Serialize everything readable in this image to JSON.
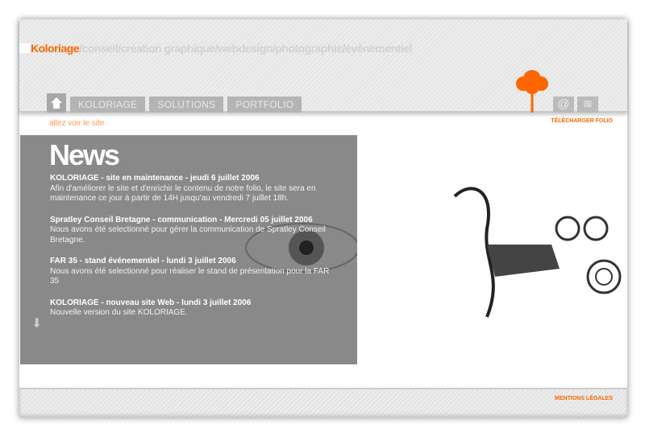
{
  "header": {
    "brand": "Koloriage",
    "slogan": "/conseil/création graphique/webdesign/photographie/événementiel"
  },
  "nav": {
    "tabs": [
      "KOLORIAGE",
      "SOLUTIONS",
      "PORTFOLIO"
    ]
  },
  "links": {
    "visit": "allez voir le site",
    "folio": "TÉLÉCHARGER FOLIO",
    "legal": "MENTIONS LÉGALES"
  },
  "icons": {
    "email": "@",
    "feed": "≋"
  },
  "news": {
    "title": "News",
    "items": [
      {
        "title": "KOLORIAGE - site en maintenance - jeudi 6 juillet 2006",
        "body": "Afin d'améliorer le site et d'enrichir le contenu de notre folio, le site sera en maintenance ce jour à partir de 14H jusqu'au vendredi 7 juillet 18h."
      },
      {
        "title": "Spratley Conseil Bretagne - communication - Mercredi 05 juillet 2006",
        "body": "Nous avons été selectionné pour gérer la communication de Spratley Conseil Bretagne."
      },
      {
        "title": "FAR 35 - stand événementiel - lundi 3 juillet 2006",
        "body": "Nous avons été selectionné pour réaliser le stand de présentation pour la FAR 35"
      },
      {
        "title": "KOLORIAGE - nouveau site Web - lundi 3 juillet 2006",
        "body": "Nouvelle version du site KOLORIAGE."
      }
    ]
  },
  "colors": {
    "accent": "#ff6600",
    "panel": "#898989"
  }
}
